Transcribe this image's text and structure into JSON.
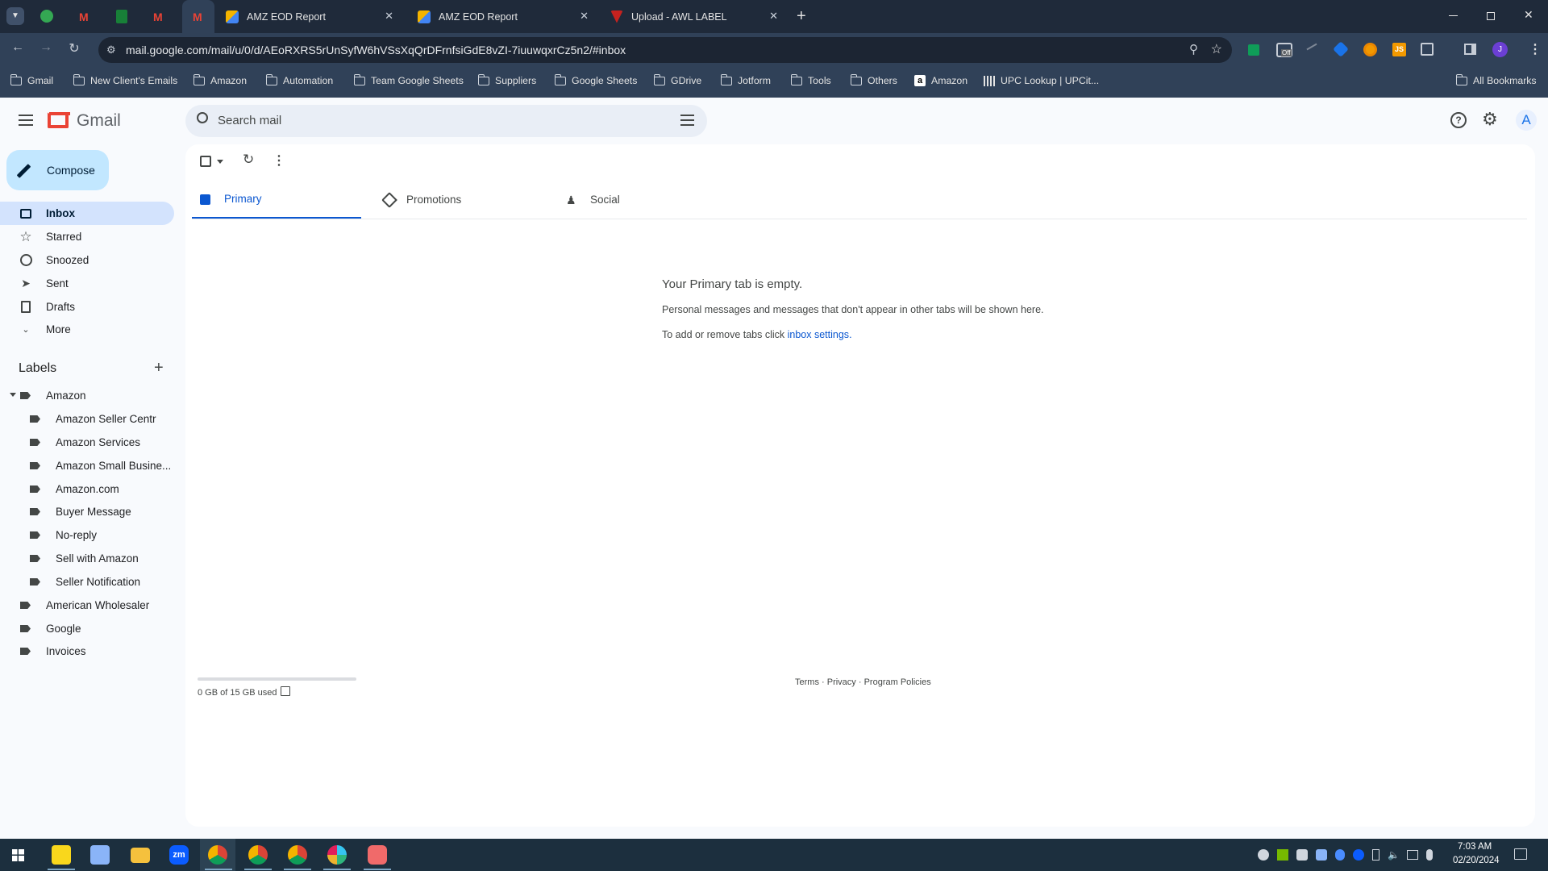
{
  "browser": {
    "tabs": [
      {
        "title": "AMZ EOD Report",
        "favicon": "cube-icon"
      },
      {
        "title": "AMZ EOD Report",
        "favicon": "cube-icon"
      },
      {
        "title": "Upload - AWL LABEL",
        "favicon": "awl-icon"
      }
    ],
    "url": "mail.google.com/mail/u/0/d/AEoRXRS5rUnSyfW6hVSsXqQrDFrnfsiGdE8vZI-7iuuwqxrCz5n2/#inbox",
    "bookmarks": [
      "Gmail",
      "New Client's Emails",
      "Amazon",
      "Automation",
      "Team Google Sheets",
      "Suppliers",
      "Google Sheets",
      "GDrive",
      "Jotform",
      "Tools",
      "Others",
      "Amazon",
      "UPC Lookup | UPCit..."
    ],
    "all_bookmarks": "All Bookmarks",
    "profile_initial": "J",
    "ext_off_badge": "Off"
  },
  "gmail": {
    "logo": "Gmail",
    "search_placeholder": "Search mail",
    "avatar": "A",
    "compose": "Compose",
    "nav": [
      "Inbox",
      "Starred",
      "Snoozed",
      "Sent",
      "Drafts",
      "More"
    ],
    "labels_title": "Labels",
    "labels": {
      "amazon": "Amazon",
      "sub": [
        "Amazon Seller Centr",
        "Amazon Services",
        "Amazon Small Busine...",
        "Amazon.com",
        "Buyer Message",
        "No-reply",
        "Sell with Amazon",
        "Seller Notification"
      ],
      "others": [
        "American Wholesaler",
        "Google",
        "Invoices"
      ]
    },
    "tabs": [
      "Primary",
      "Promotions",
      "Social"
    ],
    "empty": {
      "title": "Your Primary tab is empty.",
      "line1": "Personal messages and messages that don't appear in other tabs will be shown here.",
      "line2_prefix": "To add or remove tabs click ",
      "link": "inbox settings",
      "suffix": "."
    },
    "storage": "0 GB of 15 GB used",
    "footer": {
      "terms": "Terms",
      "dot": " · ",
      "privacy": "Privacy",
      "policies": "Program Policies"
    }
  },
  "taskbar": {
    "time": "7:03 AM",
    "date": "02/20/2024",
    "zoom_label": "zm"
  },
  "colors": {
    "accent": "#0b57d0",
    "compose": "#c2e7ff",
    "selected": "#d3e3fd",
    "chrome_dark": "#1f2a3a",
    "chrome": "#304158",
    "taskbar": "#1c2f3e"
  }
}
